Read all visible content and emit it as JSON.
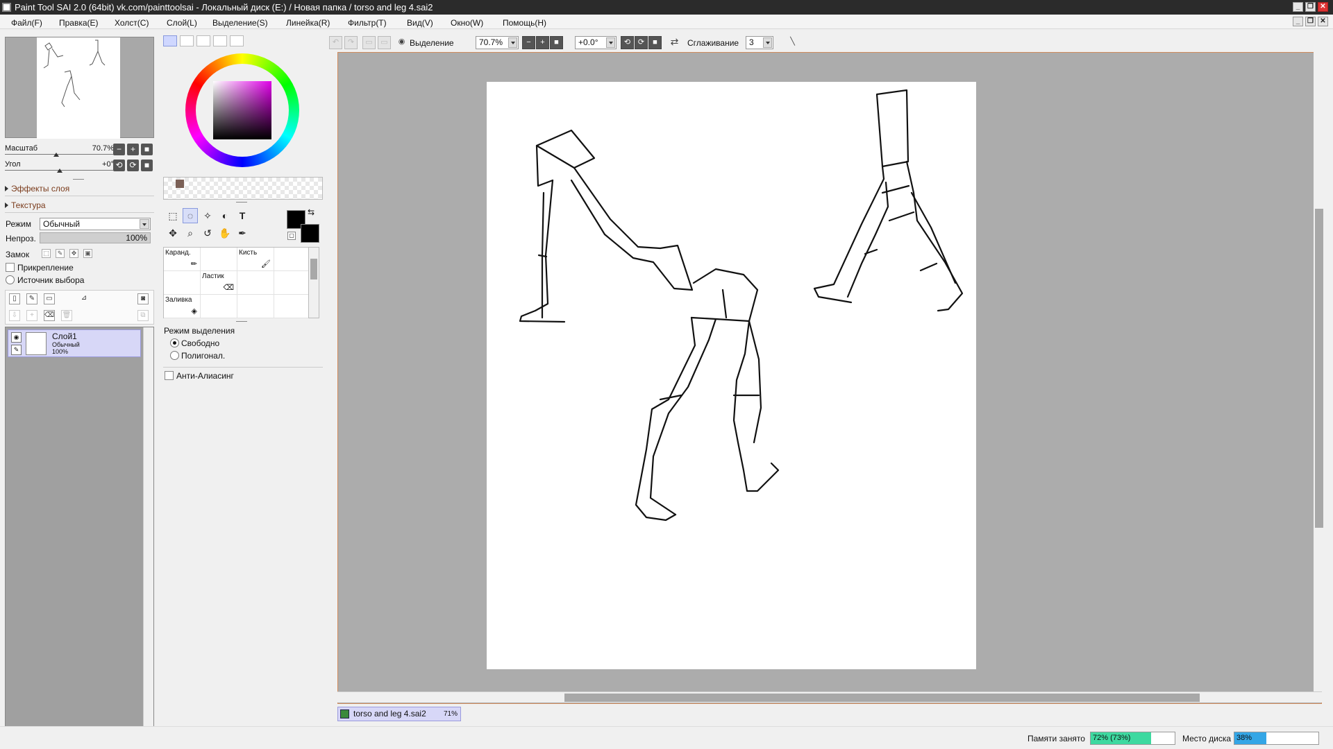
{
  "window": {
    "title": "Paint Tool SAI 2.0 (64bit) vk.com/painttoolsai - Локальный диск (E:) / Новая папка / torso and leg 4.sai2"
  },
  "menu": [
    "Файл(F)",
    "Правка(E)",
    "Холст(C)",
    "Слой(L)",
    "Выделение(S)",
    "Линейка(R)",
    "Фильтр(T)",
    "Вид(V)",
    "Окно(W)",
    "Помощь(H)"
  ],
  "navigator": {
    "zoom_label": "Масштаб",
    "zoom_value": "70.7%",
    "angle_label": "Угол",
    "angle_value": "+0°"
  },
  "layer_panel": {
    "effects": "Эффекты слоя",
    "texture": "Текстура",
    "mode_label": "Режим",
    "mode_value": "Обычный",
    "opacity_label": "Непроз.",
    "opacity_value": "100%",
    "lock_label": "Замок",
    "clip_label": "Прикрепление",
    "source_label": "Источник выбора",
    "layers": [
      {
        "name": "Слой1",
        "mode": "Обычный",
        "opacity": "100%"
      }
    ]
  },
  "tool_panel": {
    "brushes": [
      {
        "label": "Каранд."
      },
      {
        "label": "Кисть"
      },
      {
        "label": "Ластик"
      },
      {
        "label": "Заливка"
      }
    ],
    "selection_mode_title": "Режим выделения",
    "selection_modes": [
      "Свободно",
      "Полигонал."
    ],
    "selected_mode": "Свободно",
    "antialias_label": "Анти-Алиасинг",
    "swatch_color": "#7b6056",
    "fg_color": "#000000",
    "bg_color": "#000000"
  },
  "canvas_toolbar": {
    "selection_label": "Выделение",
    "zoom_value": "70.7%",
    "angle_value": "+0.0°",
    "smoothing_label": "Сглаживание",
    "smoothing_value": "3"
  },
  "document_tab": {
    "name": "torso and leg 4.sai2",
    "zoom": "71%"
  },
  "status": {
    "memory_label": "Памяти занято",
    "memory_value": "72% (73%)",
    "memory_fraction": 0.72,
    "memory_color": "#3dd9a0",
    "disk_label": "Место диска",
    "disk_value": "38%",
    "disk_fraction": 0.38,
    "disk_color": "#34a6e6"
  }
}
